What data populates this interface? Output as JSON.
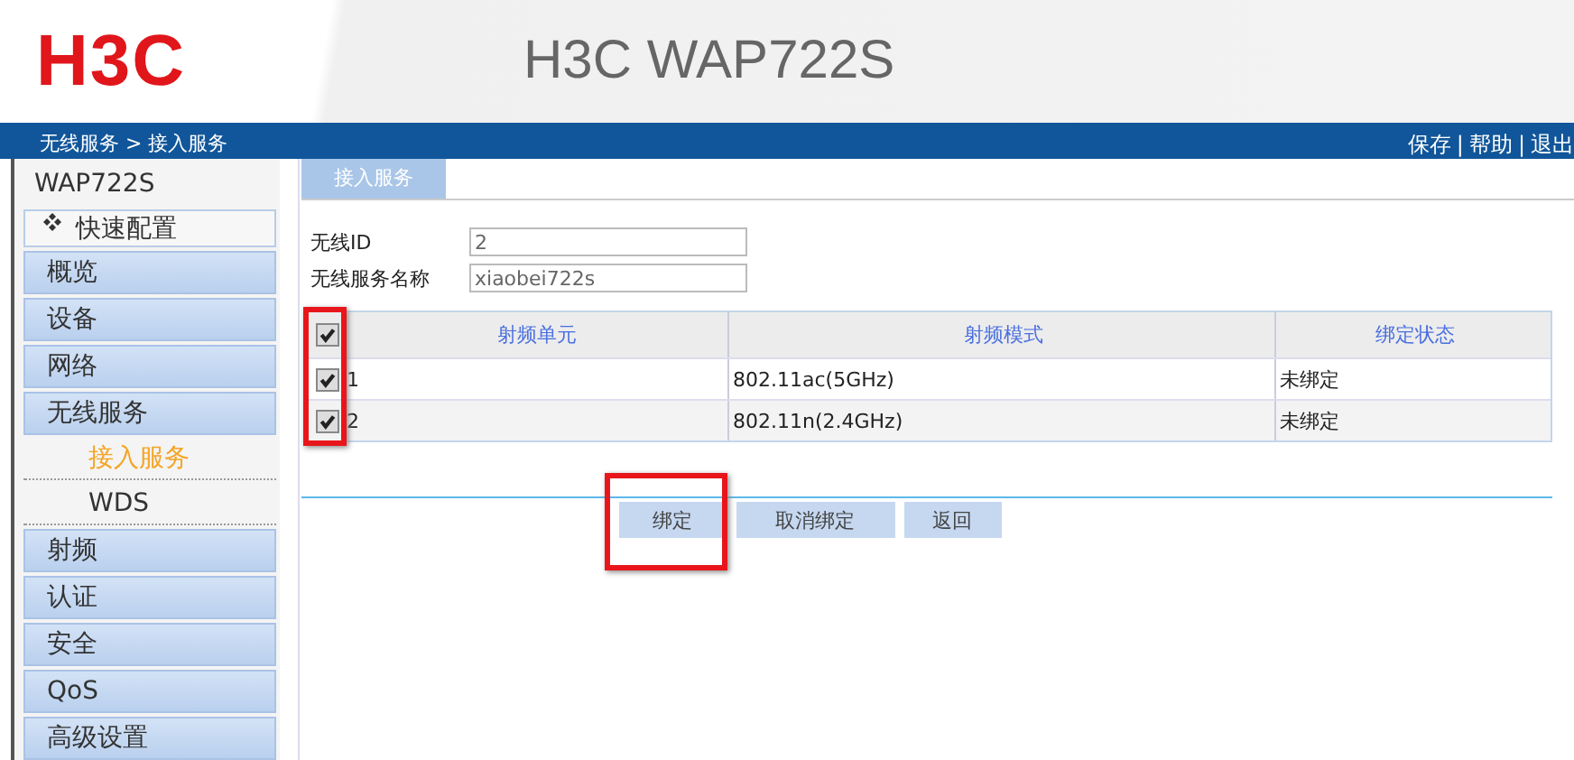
{
  "header": {
    "logo": "H3C",
    "title": "H3C WAP722S"
  },
  "navbar": {
    "breadcrumb": "无线服务 > 接入服务",
    "links": [
      "保存",
      "帮助",
      "退出"
    ],
    "separator": "|"
  },
  "sidebar": {
    "device": "WAP722S",
    "items": [
      {
        "label": "快速配置",
        "kind": "quick",
        "selected": false
      },
      {
        "label": "概览",
        "kind": "menu",
        "selected": false
      },
      {
        "label": "设备",
        "kind": "menu",
        "selected": false
      },
      {
        "label": "网络",
        "kind": "menu",
        "selected": false
      },
      {
        "label": "无线服务",
        "kind": "menu",
        "selected": false
      },
      {
        "label": "接入服务",
        "kind": "sub",
        "selected": true
      },
      {
        "label": "WDS",
        "kind": "sub",
        "selected": false
      },
      {
        "label": "射频",
        "kind": "menu",
        "selected": false
      },
      {
        "label": "认证",
        "kind": "menu",
        "selected": false
      },
      {
        "label": "安全",
        "kind": "menu",
        "selected": false
      },
      {
        "label": "QoS",
        "kind": "menu",
        "selected": false
      },
      {
        "label": "高级设置",
        "kind": "menu",
        "selected": false
      }
    ]
  },
  "tabs": [
    {
      "label": "接入服务",
      "selected": true
    }
  ],
  "form": [
    {
      "label": "无线ID",
      "value": "2"
    },
    {
      "label": "无线服务名称",
      "value": "xiaobei722s"
    }
  ],
  "table": {
    "all_checked": true,
    "columns": [
      "射频单元",
      "射频模式",
      "绑定状态"
    ],
    "rows": [
      {
        "checked": true,
        "cells": [
          "1",
          "802.11ac(5GHz)",
          "未绑定"
        ]
      },
      {
        "checked": true,
        "cells": [
          "2",
          "802.11n(2.4GHz)",
          "未绑定"
        ]
      }
    ]
  },
  "buttons": [
    "绑定",
    "取消绑定",
    "返回"
  ]
}
